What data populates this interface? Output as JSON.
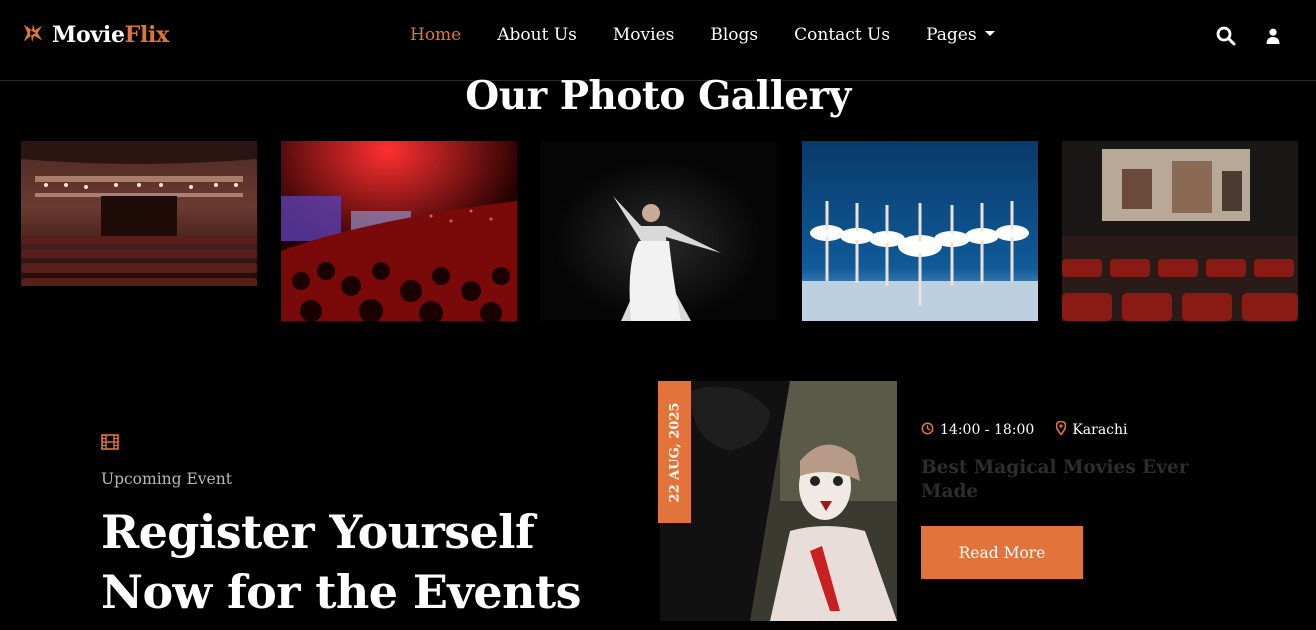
{
  "brand": {
    "name_part1": "Movie",
    "name_part2": "Flix",
    "logo_icon": "star-logo-icon"
  },
  "nav": {
    "items": [
      {
        "label": "Home",
        "active": true
      },
      {
        "label": "About Us"
      },
      {
        "label": "Movies"
      },
      {
        "label": "Blogs"
      },
      {
        "label": "Contact Us"
      },
      {
        "label": "Pages",
        "dropdown": true
      }
    ],
    "icons": [
      "search-icon",
      "user-icon"
    ]
  },
  "gallery": {
    "title": "Our Photo Gallery",
    "photos": [
      {
        "alt": "theater-auditorium-photo"
      },
      {
        "alt": "concert-crowd-photo"
      },
      {
        "alt": "solo-dancer-photo"
      },
      {
        "alt": "ballet-troupe-photo"
      },
      {
        "alt": "cinema-screen-photo"
      }
    ]
  },
  "event_section": {
    "icon": "film-icon",
    "eyebrow": "Upcoming Event",
    "title_line1": "Register Yourself",
    "title_line2": "Now for the Events"
  },
  "event_card": {
    "date": "22 AUG, 2025",
    "time": "14:00 - 18:00",
    "location": "Karachi",
    "title": "Best Magical Movies Ever Made",
    "button": "Read More",
    "image_alt": "makeup-artist-photo"
  },
  "colors": {
    "accent": "#e2743b",
    "background": "#000000",
    "muted_title": "#2d2d2d"
  }
}
